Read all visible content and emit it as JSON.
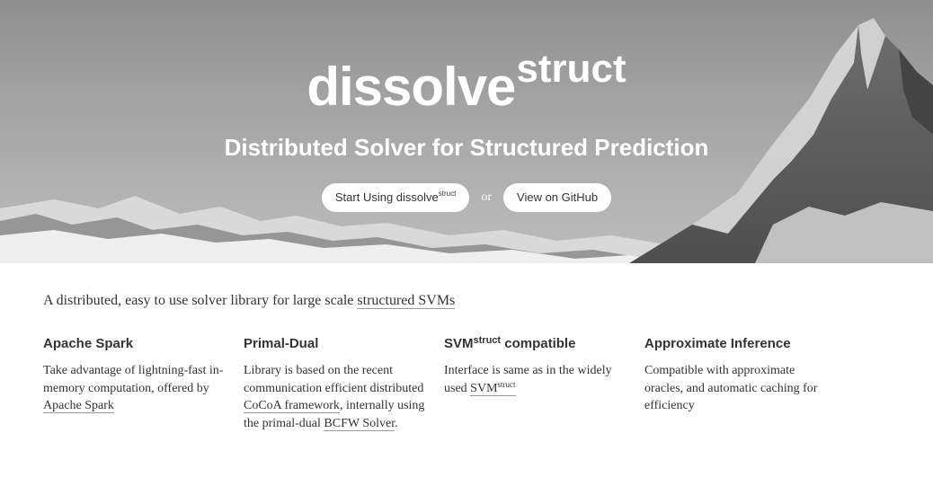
{
  "hero": {
    "brand_main": "dissolve",
    "brand_sup": "struct",
    "tagline": "Distributed Solver for Structured Prediction",
    "start_button_text": "Start Using dissolve",
    "start_button_sup": "struct",
    "or_text": "or",
    "github_button_text": "View on GitHub"
  },
  "lead": {
    "text": "A distributed, easy to use solver library for large scale ",
    "link": "structured SVMs"
  },
  "features": [
    {
      "title": "Apache Spark",
      "text": "Take advantage of lightning-fast in-memory computation, offered by ",
      "link": "Apache Spark"
    },
    {
      "title": "Primal-Dual",
      "text_a": "Library is based on the recent communication efficient distributed ",
      "link_a": "CoCoA framework",
      "text_b": ", internally using the primal-dual ",
      "link_b": "BCFW Solver",
      "text_c": "."
    },
    {
      "title_main": "SVM",
      "title_sup": "struct",
      "title_tail": " compatible",
      "text": "Interface is same as in the widely used ",
      "link_main": "SVM",
      "link_sup": "struct"
    },
    {
      "title": "Approximate Inference",
      "text": "Compatible with approximate oracles, and automatic caching for efficiency"
    }
  ]
}
